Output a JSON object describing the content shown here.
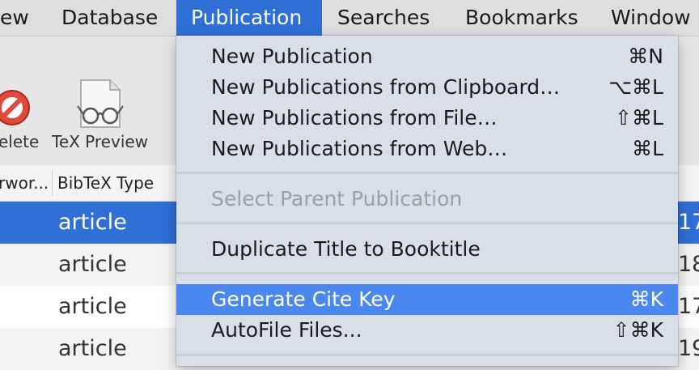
{
  "menubar": {
    "items": [
      "ew",
      "Database",
      "Publication",
      "Searches",
      "Bookmarks",
      "Window"
    ],
    "active": "Publication"
  },
  "toolbar": {
    "delete_label": "elete",
    "tex_preview_label": "TeX Preview"
  },
  "table": {
    "headers": [
      "rwor...",
      "BibTeX Type"
    ],
    "rows": [
      {
        "type": "article",
        "trailing": "17"
      },
      {
        "type": "article",
        "trailing": "18"
      },
      {
        "type": "article",
        "trailing": "17"
      },
      {
        "type": "article",
        "trailing": "19"
      }
    ]
  },
  "publication_menu": {
    "items": [
      {
        "label": "New Publication",
        "shortcut": "⌘N"
      },
      {
        "label": "New Publications from Clipboard…",
        "shortcut": "⌥⌘L"
      },
      {
        "label": "New Publications from File…",
        "shortcut": "⇧⌘L"
      },
      {
        "label": "New Publications from Web…",
        "shortcut": "⌘L"
      },
      {
        "label": "Select Parent Publication",
        "shortcut": ""
      },
      {
        "label": "Duplicate Title to Booktitle",
        "shortcut": ""
      },
      {
        "label": "Generate Cite Key",
        "shortcut": "⌘K"
      },
      {
        "label": "AutoFile Files...",
        "shortcut": "⇧⌘K"
      }
    ],
    "highlighted": "Generate Cite Key",
    "disabled": [
      "Select Parent Publication"
    ]
  },
  "colors": {
    "accent": "#2f6fd6",
    "menu_highlight": "#4a88ef"
  },
  "icons": [
    "delete-icon",
    "tex-preview-icon"
  ]
}
